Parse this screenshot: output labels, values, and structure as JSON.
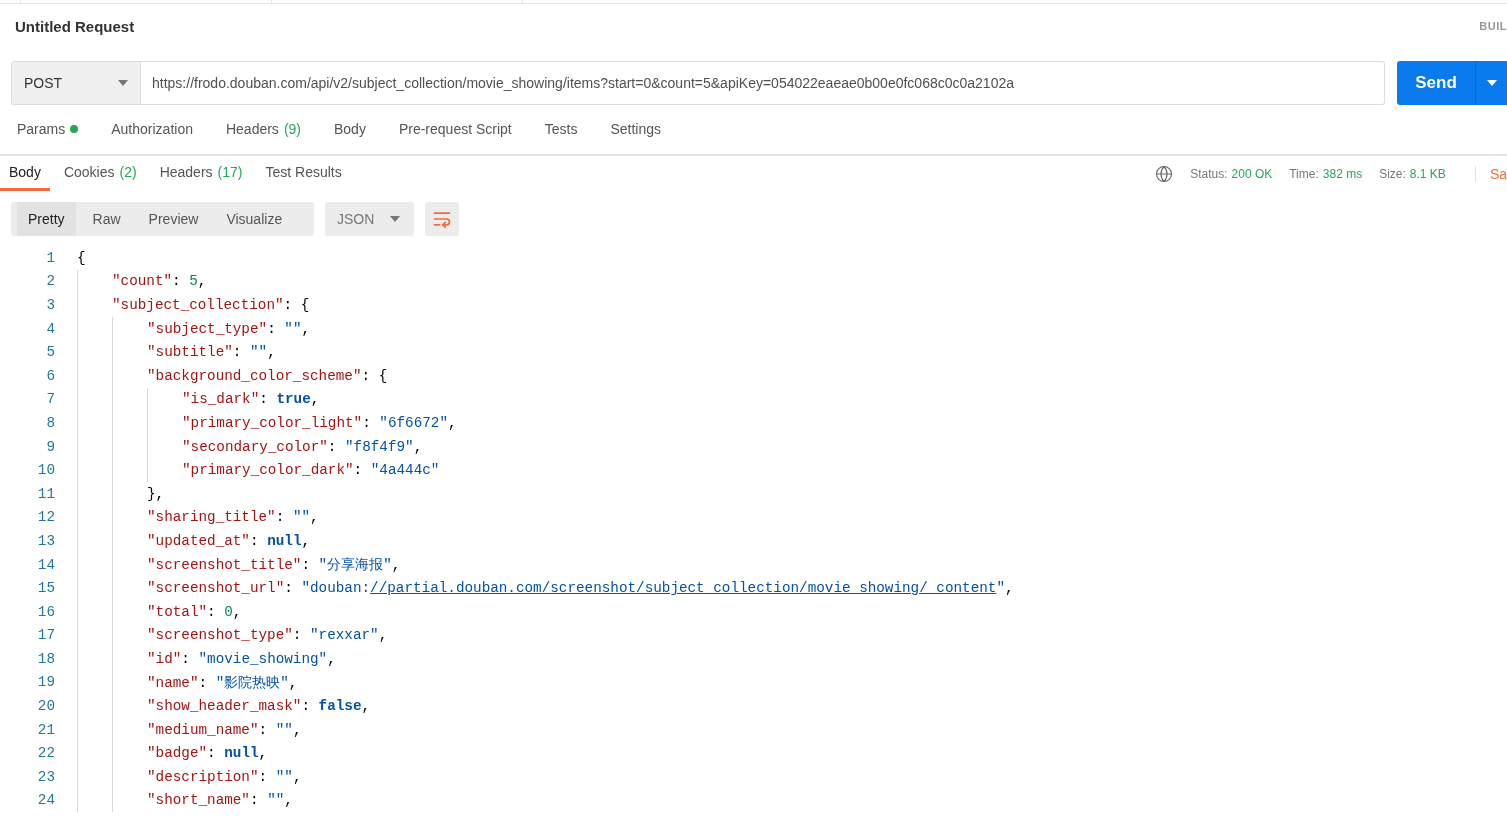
{
  "tab_title": "Untitled Request",
  "build_label": "BUIL",
  "request": {
    "method": "POST",
    "url": "https://frodo.douban.com/api/v2/subject_collection/movie_showing/items?start=0&count=5&apiKey=054022eaeae0b00e0fc068c0c0a2102a",
    "send": "Send"
  },
  "request_tabs": [
    {
      "label": "Params",
      "indicator": true
    },
    {
      "label": "Authorization",
      "indicator": false
    },
    {
      "label": "Headers",
      "count": "(9)",
      "indicator": false
    },
    {
      "label": "Body",
      "indicator": false
    },
    {
      "label": "Pre-request Script",
      "indicator": false
    },
    {
      "label": "Tests",
      "indicator": false
    },
    {
      "label": "Settings",
      "indicator": false
    }
  ],
  "response_tabs": [
    {
      "label": "Body",
      "selected": true
    },
    {
      "label": "Cookies",
      "count": "(2)",
      "selected": false
    },
    {
      "label": "Headers",
      "count": "(17)",
      "selected": false
    },
    {
      "label": "Test Results",
      "selected": false
    }
  ],
  "response_meta": [
    {
      "label": "Status:",
      "value": "200 OK"
    },
    {
      "label": "Time:",
      "value": "382 ms"
    },
    {
      "label": "Size:",
      "value": "8.1 KB"
    }
  ],
  "save_label": "Sa",
  "view_modes": [
    {
      "label": "Pretty",
      "selected": true
    },
    {
      "label": "Raw",
      "selected": false
    },
    {
      "label": "Preview",
      "selected": false
    },
    {
      "label": "Visualize",
      "selected": false
    }
  ],
  "format": "JSON",
  "code": [
    {
      "number": "1",
      "tokens": [
        {
          "kind": "punct",
          "text": "{"
        }
      ],
      "children": [
        {
          "number": "2",
          "tokens": [
            {
              "kind": "key",
              "text": "\"count\""
            },
            {
              "kind": "punct",
              "text": ": "
            },
            {
              "kind": "number",
              "text": "5"
            },
            {
              "kind": "punct",
              "text": ","
            }
          ]
        },
        {
          "number": "3",
          "tokens": [
            {
              "kind": "key",
              "text": "\"subject_collection\""
            },
            {
              "kind": "punct",
              "text": ": {"
            }
          ],
          "children": [
            {
              "number": "4",
              "tokens": [
                {
                  "kind": "key",
                  "text": "\"subject_type\""
                },
                {
                  "kind": "punct",
                  "text": ": "
                },
                {
                  "kind": "string",
                  "text": "\"\""
                },
                {
                  "kind": "punct",
                  "text": ","
                }
              ]
            },
            {
              "number": "5",
              "tokens": [
                {
                  "kind": "key",
                  "text": "\"subtitle\""
                },
                {
                  "kind": "punct",
                  "text": ": "
                },
                {
                  "kind": "string",
                  "text": "\"\""
                },
                {
                  "kind": "punct",
                  "text": ","
                }
              ]
            },
            {
              "number": "6",
              "tokens": [
                {
                  "kind": "key",
                  "text": "\"background_color_scheme\""
                },
                {
                  "kind": "punct",
                  "text": ": {"
                }
              ],
              "children": [
                {
                  "number": "7",
                  "tokens": [
                    {
                      "kind": "key",
                      "text": "\"is_dark\""
                    },
                    {
                      "kind": "punct",
                      "text": ": "
                    },
                    {
                      "kind": "literal",
                      "text": "true"
                    },
                    {
                      "kind": "punct",
                      "text": ","
                    }
                  ]
                },
                {
                  "number": "8",
                  "tokens": [
                    {
                      "kind": "key",
                      "text": "\"primary_color_light\""
                    },
                    {
                      "kind": "punct",
                      "text": ": "
                    },
                    {
                      "kind": "string",
                      "text": "\"6f6672\""
                    },
                    {
                      "kind": "punct",
                      "text": ","
                    }
                  ]
                },
                {
                  "number": "9",
                  "tokens": [
                    {
                      "kind": "key",
                      "text": "\"secondary_color\""
                    },
                    {
                      "kind": "punct",
                      "text": ": "
                    },
                    {
                      "kind": "string",
                      "text": "\"f8f4f9\""
                    },
                    {
                      "kind": "punct",
                      "text": ","
                    }
                  ]
                },
                {
                  "number": "10",
                  "tokens": [
                    {
                      "kind": "key",
                      "text": "\"primary_color_dark\""
                    },
                    {
                      "kind": "punct",
                      "text": ": "
                    },
                    {
                      "kind": "string",
                      "text": "\"4a444c\""
                    }
                  ]
                }
              ]
            },
            {
              "number": "11",
              "tokens": [
                {
                  "kind": "punct",
                  "text": "},"
                }
              ]
            },
            {
              "number": "12",
              "tokens": [
                {
                  "kind": "key",
                  "text": "\"sharing_title\""
                },
                {
                  "kind": "punct",
                  "text": ": "
                },
                {
                  "kind": "string",
                  "text": "\"\""
                },
                {
                  "kind": "punct",
                  "text": ","
                }
              ]
            },
            {
              "number": "13",
              "tokens": [
                {
                  "kind": "key",
                  "text": "\"updated_at\""
                },
                {
                  "kind": "punct",
                  "text": ": "
                },
                {
                  "kind": "literal",
                  "text": "null"
                },
                {
                  "kind": "punct",
                  "text": ","
                }
              ]
            },
            {
              "number": "14",
              "tokens": [
                {
                  "kind": "key",
                  "text": "\"screenshot_title\""
                },
                {
                  "kind": "punct",
                  "text": ": "
                },
                {
                  "kind": "string",
                  "text": "\"分享海报\""
                },
                {
                  "kind": "punct",
                  "text": ","
                }
              ]
            },
            {
              "number": "15",
              "tokens": [
                {
                  "kind": "key",
                  "text": "\"screenshot_url\""
                },
                {
                  "kind": "punct",
                  "text": ": "
                },
                {
                  "kind": "string",
                  "text": "\"douban:"
                },
                {
                  "kind": "link",
                  "text": "//partial.douban.com/screenshot/subject_collection/movie_showing/_content"
                },
                {
                  "kind": "string",
                  "text": "\""
                },
                {
                  "kind": "punct",
                  "text": ","
                }
              ]
            },
            {
              "number": "16",
              "tokens": [
                {
                  "kind": "key",
                  "text": "\"total\""
                },
                {
                  "kind": "punct",
                  "text": ": "
                },
                {
                  "kind": "number",
                  "text": "0"
                },
                {
                  "kind": "punct",
                  "text": ","
                }
              ]
            },
            {
              "number": "17",
              "tokens": [
                {
                  "kind": "key",
                  "text": "\"screenshot_type\""
                },
                {
                  "kind": "punct",
                  "text": ": "
                },
                {
                  "kind": "string",
                  "text": "\"rexxar\""
                },
                {
                  "kind": "punct",
                  "text": ","
                }
              ]
            },
            {
              "number": "18",
              "tokens": [
                {
                  "kind": "key",
                  "text": "\"id\""
                },
                {
                  "kind": "punct",
                  "text": ": "
                },
                {
                  "kind": "string",
                  "text": "\"movie_showing\""
                },
                {
                  "kind": "punct",
                  "text": ","
                }
              ]
            },
            {
              "number": "19",
              "tokens": [
                {
                  "kind": "key",
                  "text": "\"name\""
                },
                {
                  "kind": "punct",
                  "text": ": "
                },
                {
                  "kind": "string",
                  "text": "\"影院热映\""
                },
                {
                  "kind": "punct",
                  "text": ","
                }
              ]
            },
            {
              "number": "20",
              "tokens": [
                {
                  "kind": "key",
                  "text": "\"show_header_mask\""
                },
                {
                  "kind": "punct",
                  "text": ": "
                },
                {
                  "kind": "literal",
                  "text": "false"
                },
                {
                  "kind": "punct",
                  "text": ","
                }
              ]
            },
            {
              "number": "21",
              "tokens": [
                {
                  "kind": "key",
                  "text": "\"medium_name\""
                },
                {
                  "kind": "punct",
                  "text": ": "
                },
                {
                  "kind": "string",
                  "text": "\"\""
                },
                {
                  "kind": "punct",
                  "text": ","
                }
              ]
            },
            {
              "number": "22",
              "tokens": [
                {
                  "kind": "key",
                  "text": "\"badge\""
                },
                {
                  "kind": "punct",
                  "text": ": "
                },
                {
                  "kind": "literal",
                  "text": "null"
                },
                {
                  "kind": "punct",
                  "text": ","
                }
              ]
            },
            {
              "number": "23",
              "tokens": [
                {
                  "kind": "key",
                  "text": "\"description\""
                },
                {
                  "kind": "punct",
                  "text": ": "
                },
                {
                  "kind": "string",
                  "text": "\"\""
                },
                {
                  "kind": "punct",
                  "text": ","
                }
              ]
            },
            {
              "number": "24",
              "tokens": [
                {
                  "kind": "key",
                  "text": "\"short_name\""
                },
                {
                  "kind": "punct",
                  "text": ": "
                },
                {
                  "kind": "string",
                  "text": "\"\""
                },
                {
                  "kind": "punct",
                  "text": ","
                }
              ]
            }
          ]
        }
      ]
    }
  ]
}
